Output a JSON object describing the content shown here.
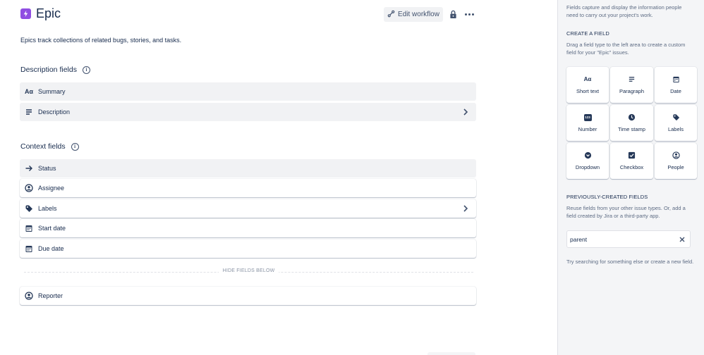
{
  "header": {
    "title": "Epic",
    "edit_workflow_label": "Edit workflow",
    "accent": "#904ee2"
  },
  "description": "Epics track collections of related bugs, stories, and tasks.",
  "description_fields": {
    "title": "Description fields",
    "rows": [
      {
        "label": "Summary",
        "icon": "text-aa-icon"
      },
      {
        "label": "Description",
        "icon": "paragraph-icon"
      }
    ]
  },
  "context_fields": {
    "title": "Context fields",
    "rows": [
      {
        "label": "Status",
        "icon": "arrow-right-icon"
      },
      {
        "label": "Assignee",
        "icon": "person-icon"
      },
      {
        "label": "Labels",
        "icon": "tag-icon"
      },
      {
        "label": "Start date",
        "icon": "calendar-icon"
      },
      {
        "label": "Due date",
        "icon": "calendar-icon"
      }
    ],
    "hide_fields_label": "HIDE FIELDS BELOW",
    "hidden_rows": [
      {
        "label": "Reporter",
        "icon": "person-icon"
      }
    ]
  },
  "panel": {
    "intro": "Fields capture and display the information people need to carry out your project's work.",
    "create_heading": "CREATE A FIELD",
    "create_text": "Drag a field type to the left area to create a custom field for your \"Epic\" issues.",
    "field_types": [
      {
        "label": "Short text",
        "icon": "text-aa-icon"
      },
      {
        "label": "Paragraph",
        "icon": "paragraph-icon"
      },
      {
        "label": "Date",
        "icon": "calendar-icon"
      },
      {
        "label": "Number",
        "icon": "number-icon"
      },
      {
        "label": "Time stamp",
        "icon": "clock-icon"
      },
      {
        "label": "Labels",
        "icon": "tag-icon"
      },
      {
        "label": "Dropdown",
        "icon": "dropdown-icon"
      },
      {
        "label": "Checkbox",
        "icon": "checkbox-icon"
      },
      {
        "label": "People",
        "icon": "person-icon"
      }
    ],
    "number_icon_text": "123",
    "aa_icon_text": "Aα",
    "prev_heading": "PREVIOUSLY-CREATED FIELDS",
    "prev_text": "Reuse fields from your other issue types. Or, add a field created by Jira or a third-party app.",
    "search_value": "parent",
    "empty_text": "Try searching for something else or create a new field."
  }
}
